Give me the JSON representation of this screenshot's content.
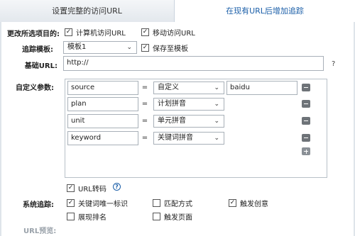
{
  "tabs": [
    {
      "label": "设置完整的访问URL",
      "active": false
    },
    {
      "label": "在现有URL后增加追踪",
      "active": true
    }
  ],
  "form": {
    "target_label": "更改所选项目的:",
    "target_options": [
      {
        "label": "计算机访问URL",
        "checked": true
      },
      {
        "label": "移动访问URL",
        "checked": true
      }
    ],
    "template_label": "追踪模板:",
    "template_value": "模板1",
    "save_template": {
      "label": "保存至模板",
      "checked": true
    },
    "base_url_label": "基础URL:",
    "base_url_value": "http://",
    "base_url_help": "?",
    "custom_params_label": "自定义参数:",
    "params": [
      {
        "key": "source",
        "eq": "=",
        "type": "自定义",
        "value": "baidu"
      },
      {
        "key": "plan",
        "eq": "=",
        "type": "计划拼音",
        "value": ""
      },
      {
        "key": "unit",
        "eq": "=",
        "type": "单元拼音",
        "value": ""
      },
      {
        "key": "keyword",
        "eq": "=",
        "type": "关键词拼音",
        "value": ""
      }
    ],
    "url_encode": {
      "label": "URL转码",
      "checked": true,
      "help": "?"
    },
    "system_tracking_label": "系统追踪:",
    "system_tracking_options": [
      {
        "label": "关键词唯一标识",
        "checked": true
      },
      {
        "label": "匹配方式",
        "checked": false
      },
      {
        "label": "触发创意",
        "checked": true
      },
      {
        "label": "展现排名",
        "checked": false
      },
      {
        "label": "触发页面",
        "checked": false
      }
    ],
    "preview_label": "URL预览:"
  },
  "icons": {
    "dropdown": "chevron-down-icon",
    "remove": "minus-icon",
    "add": "plus-icon",
    "help": "question-circle-icon"
  },
  "colors": {
    "accent": "#1a5ea8",
    "tab_inactive_bg": "#e8ecf0",
    "border": "#a8b0b8"
  }
}
